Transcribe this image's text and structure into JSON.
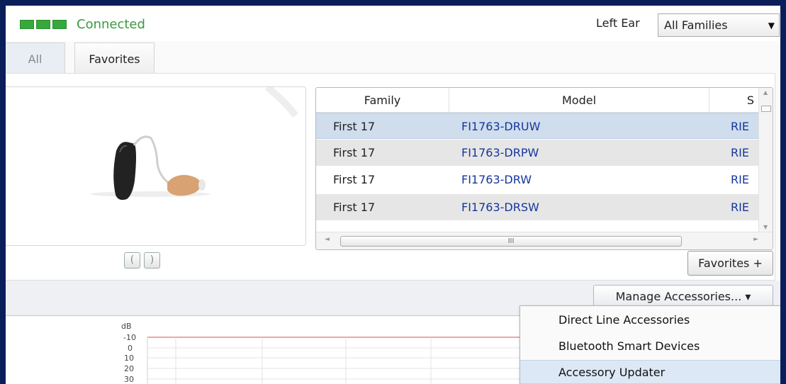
{
  "status": {
    "text": "Connected",
    "bars": 3,
    "color": "#37a83c"
  },
  "ear": {
    "label": "Left Ear",
    "family_value": "All Families"
  },
  "tabs": [
    {
      "label": "All"
    },
    {
      "label": "Favorites"
    }
  ],
  "table": {
    "columns": [
      "Family",
      "Model",
      "S"
    ],
    "rows": [
      {
        "family": "First 17",
        "model": "FI1763-DRUW",
        "style": "RIE"
      },
      {
        "family": "First 17",
        "model": "FI1763-DRPW",
        "style": "RIE"
      },
      {
        "family": "First 17",
        "model": "FI1763-DRW",
        "style": "RIE"
      },
      {
        "family": "First 17",
        "model": "FI1763-DRSW",
        "style": "RIE"
      }
    ],
    "hscroll_grip": "III"
  },
  "favorites_add_label": "Favorites +",
  "side_buttons": [
    "(",
    ")"
  ],
  "manage_label": "Manage Accessories... ▾",
  "menu": {
    "items": [
      "Direct Line Accessories",
      "Bluetooth Smart Devices",
      "Accessory Updater"
    ],
    "highlighted_index": 2
  },
  "audiogram": {
    "unit": "dB",
    "ticks": [
      "-10",
      "0",
      "10",
      "20",
      "30"
    ],
    "line_color": "#e24b4b"
  },
  "colors": {
    "selected_row": "#cfdded",
    "link_text": "#16379c",
    "frame": "#0b1e5a"
  }
}
